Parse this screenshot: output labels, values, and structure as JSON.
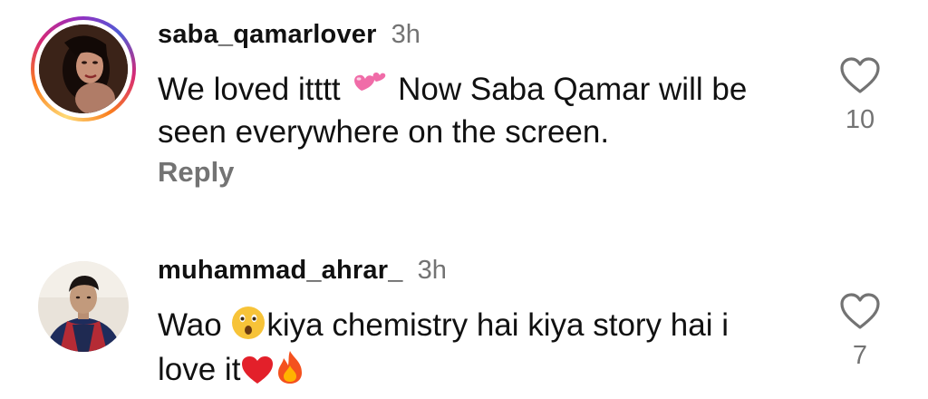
{
  "comments": [
    {
      "username": "saba_qamarlover",
      "time": "3h",
      "text_part1": "We loved itttt",
      "text_emoji": "two-hearts",
      "text_part2": " Now Saba Qamar will be seen everywhere on the screen.",
      "reply_label": "Reply",
      "like_count": "10",
      "avatar": "woman-portrait-avatar",
      "has_story_ring": true
    },
    {
      "username": "muhammad_ahrar_",
      "time": "3h",
      "text_part1": "Wao ",
      "text_emoji1": "astonished-face",
      "text_part2": "kiya chemistry hai kiya story hai i love it",
      "text_emoji2": "red-heart",
      "text_emoji3": "fire",
      "like_count": "7",
      "avatar": "man-portrait-avatar",
      "has_story_ring": false
    }
  ],
  "colors": {
    "text": "#111111",
    "muted": "#737373",
    "ring": [
      "#feda75",
      "#fa7e1e",
      "#d62976",
      "#962fbf",
      "#4f5bd5"
    ]
  }
}
